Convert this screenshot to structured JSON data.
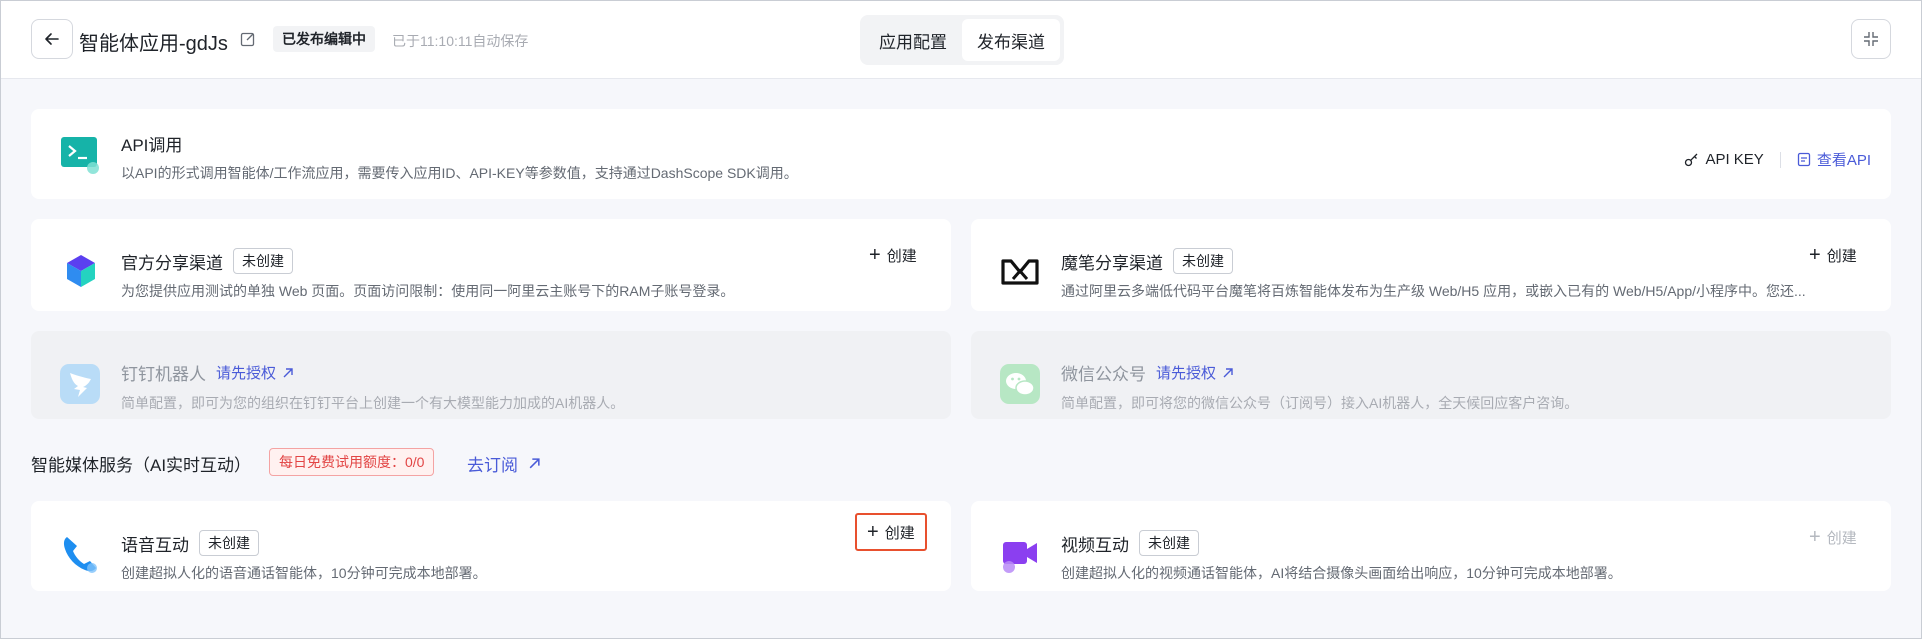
{
  "header": {
    "app_title": "智能体应用-gdJs",
    "status_badge": "已发布编辑中",
    "autosave": "已于11:10:11自动保存",
    "tabs": [
      {
        "label": "应用配置",
        "active": false
      },
      {
        "label": "发布渠道",
        "active": true
      }
    ]
  },
  "api_card": {
    "title": "API调用",
    "desc": "以API的形式调用智能体/工作流应用，需要传入应用ID、API-KEY等参数值，支持通过DashScope SDK调用。",
    "api_key_label": "API KEY",
    "view_api_label": "查看API"
  },
  "channels": [
    {
      "title": "官方分享渠道",
      "tag": "未创建",
      "desc": "为您提供应用测试的单独 Web 页面。页面访问限制：使用同一阿里云主账号下的RAM子账号登录。",
      "create_label": "创建"
    },
    {
      "title": "魔笔分享渠道",
      "tag": "未创建",
      "desc": "通过阿里云多端低代码平台魔笔将百炼智能体发布为生产级 Web/H5 应用，或嵌入已有的 Web/H5/App/小程序中。您还...",
      "create_label": "创建"
    },
    {
      "title": "钉钉机器人",
      "auth_label": "请先授权",
      "desc": "简单配置，即可为您的组织在钉钉平台上创建一个有大模型能力加成的AI机器人。"
    },
    {
      "title": "微信公众号",
      "auth_label": "请先授权",
      "desc": "简单配置，即可将您的微信公众号（订阅号）接入AI机器人，全天候回应客户咨询。"
    }
  ],
  "media_section": {
    "title": "智能媒体服务（AI实时互动）",
    "quota": "每日免费试用额度：0/0",
    "subscribe_label": "去订阅"
  },
  "media": [
    {
      "title": "语音互动",
      "tag": "未创建",
      "desc": "创建超拟人化的语音通话智能体，10分钟可完成本地部署。",
      "create_label": "创建"
    },
    {
      "title": "视频互动",
      "tag": "未创建",
      "desc": "创建超拟人化的视频通话智能体，AI将结合摄像头画面给出响应，10分钟可完成本地部署。",
      "create_label": "创建"
    }
  ],
  "colors": {
    "accent": "#4a5bd8",
    "highlight": "#e8502e",
    "danger": "#e24545"
  }
}
